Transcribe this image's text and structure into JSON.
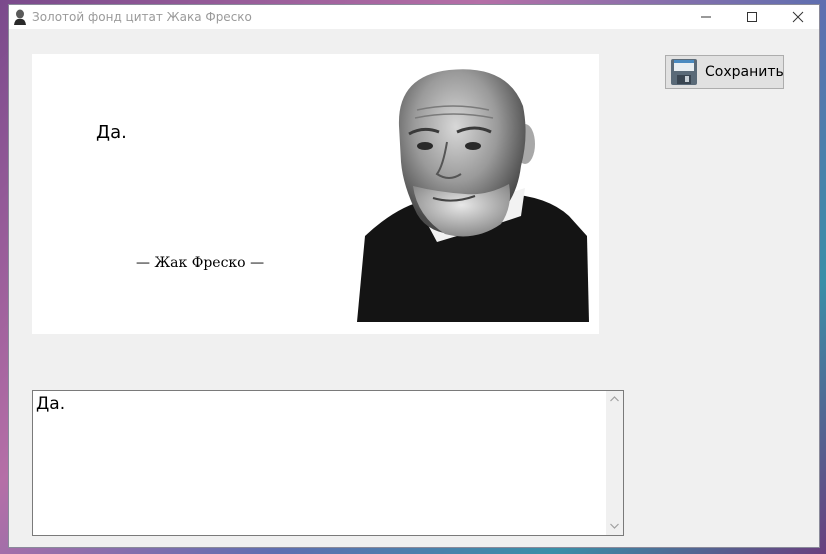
{
  "window": {
    "title": "Золотой фонд цитат Жака Фреско"
  },
  "quote_card": {
    "quote": "Да.",
    "author": "— Жак Фреско —"
  },
  "toolbar": {
    "save_label": "Сохранить"
  },
  "editor": {
    "text": "Да."
  },
  "colors": {
    "window_bg": "#f0f0f0",
    "titlebar_bg": "#ffffff",
    "title_text": "#9a9a9a",
    "button_bg": "#e1e1e1"
  },
  "icons": {
    "app": "person-portrait-icon",
    "save": "floppy-disk-icon",
    "minimize": "minimize-icon",
    "maximize": "maximize-icon",
    "close": "close-icon"
  }
}
